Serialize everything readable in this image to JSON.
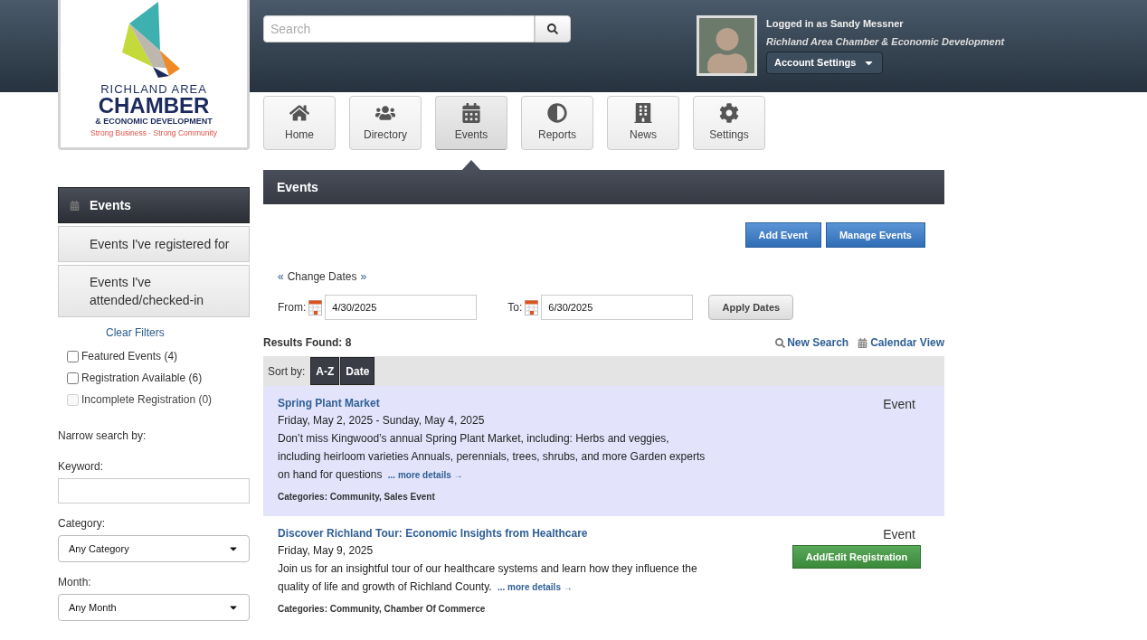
{
  "header": {
    "search": {
      "placeholder": "Search"
    },
    "user": {
      "logged_in": "Logged in as Sandy Messner",
      "organization": "Richland Area Chamber & Economic Development",
      "account_button": "Account Settings"
    }
  },
  "logo": {
    "line_1": "RICHLAND AREA",
    "line_2": "CHAMBER",
    "line_3": "& ECONOMIC DEVELOPMENT",
    "tagline": "Strong Business · Strong Community"
  },
  "nav": [
    {
      "label": "Home",
      "selected": false
    },
    {
      "label": "Directory",
      "selected": false
    },
    {
      "label": "Events",
      "selected": true
    },
    {
      "label": "Reports",
      "selected": false
    },
    {
      "label": "News",
      "selected": false
    },
    {
      "label": "Settings",
      "selected": false
    }
  ],
  "sidebar": {
    "items": [
      {
        "label": "Events",
        "selected": true
      },
      {
        "label": "Events I've registered for",
        "selected": false
      },
      {
        "label": "Events I've attended/checked-in",
        "selected": false
      }
    ],
    "clear_filters": "Clear Filters",
    "filters": [
      {
        "label": "Featured Events (4)",
        "checked": false,
        "disabled": false
      },
      {
        "label": "Registration Available (6)",
        "checked": false,
        "disabled": false
      },
      {
        "label": "Incomplete Registration (0)",
        "checked": false,
        "disabled": true
      }
    ],
    "narrow_label": "Narrow search by:",
    "keyword_label": "Keyword:",
    "category_label": "Category:",
    "category_value": "Any Category",
    "month_label": "Month:",
    "month_value": "Any Month"
  },
  "content": {
    "title": "Events",
    "buttons": [
      "Add Event",
      "Manage Events"
    ],
    "change_dates": {
      "left": "«",
      "label": "Change Dates",
      "right": "»"
    },
    "from_label": "From:",
    "from_value": "4/30/2025",
    "to_label": "To:",
    "to_value": "6/30/2025",
    "apply": "Apply Dates",
    "results": "Results Found: 8",
    "new_search": "New Search",
    "calendar_view": "Calendar View",
    "sort_label": "Sort by:",
    "sort_options": [
      "A-Z",
      "Date"
    ],
    "events": [
      {
        "title": "Spring Plant Market",
        "dates": "Friday, May 2, 2025 - Sunday, May 4, 2025",
        "description": "Don’t miss Kingwood’s annual Spring Plant Market, including: Herbs and veggies, including heirloom varieties Annuals, perennials, trees, shrubs, and more Garden experts on hand for questions",
        "more": "... more details →",
        "categories": "Categories: Community, Sales Event",
        "type": "Event",
        "highlighted": true
      },
      {
        "title": "Discover Richland Tour: Economic Insights from Healthcare",
        "dates": "Friday, May 9, 2025",
        "description": "Join us for an insightful tour of our healthcare systems and learn how they influence the quality of life and growth of Richland County.",
        "more": "... more details →",
        "categories": "Categories: Community, Chamber Of Commerce",
        "type": "Event",
        "highlighted": false,
        "action": "Add/Edit Registration"
      }
    ]
  }
}
